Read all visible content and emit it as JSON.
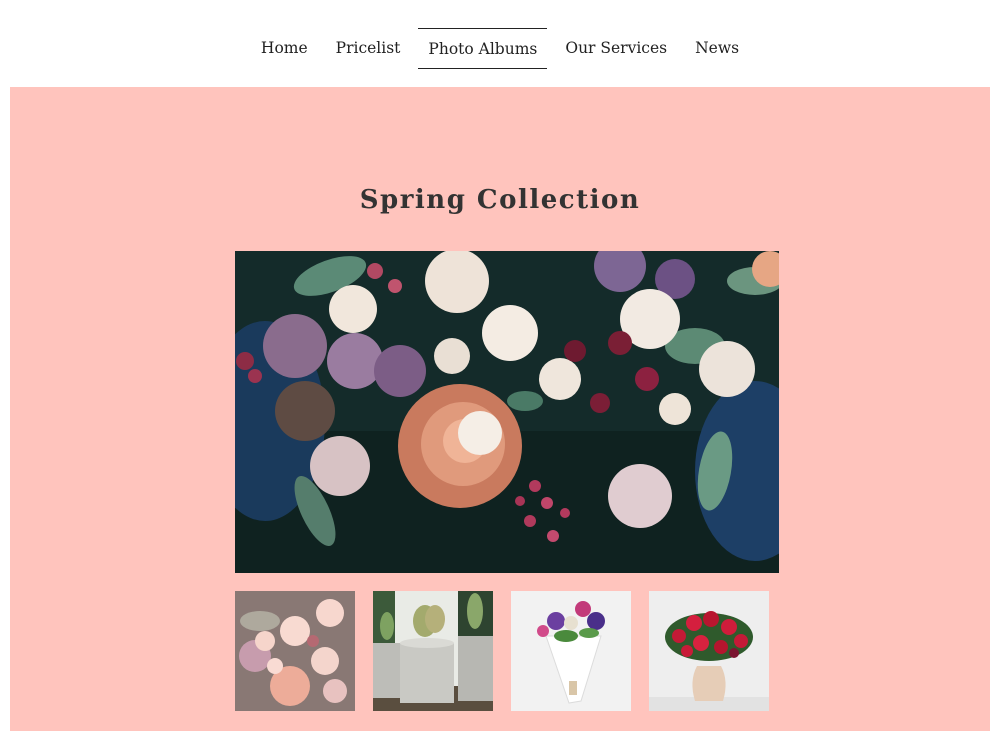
{
  "nav": {
    "items": [
      {
        "label": "Home"
      },
      {
        "label": "Pricelist"
      },
      {
        "label": "Photo Albums",
        "active": true
      },
      {
        "label": "Our Services"
      },
      {
        "label": "News"
      }
    ]
  },
  "album": {
    "title": "Spring Collection",
    "main_photo": "floral-bouquet-photo",
    "thumbnails": [
      {
        "name": "floral-bouquet-thumb",
        "selected": true
      },
      {
        "name": "cactus-pots-thumb",
        "selected": false
      },
      {
        "name": "wildflower-bouquet-thumb",
        "selected": false
      },
      {
        "name": "red-roses-vase-thumb",
        "selected": false
      }
    ]
  },
  "colors": {
    "hero_background": "#ffc4bd",
    "nav_text": "#222222"
  }
}
